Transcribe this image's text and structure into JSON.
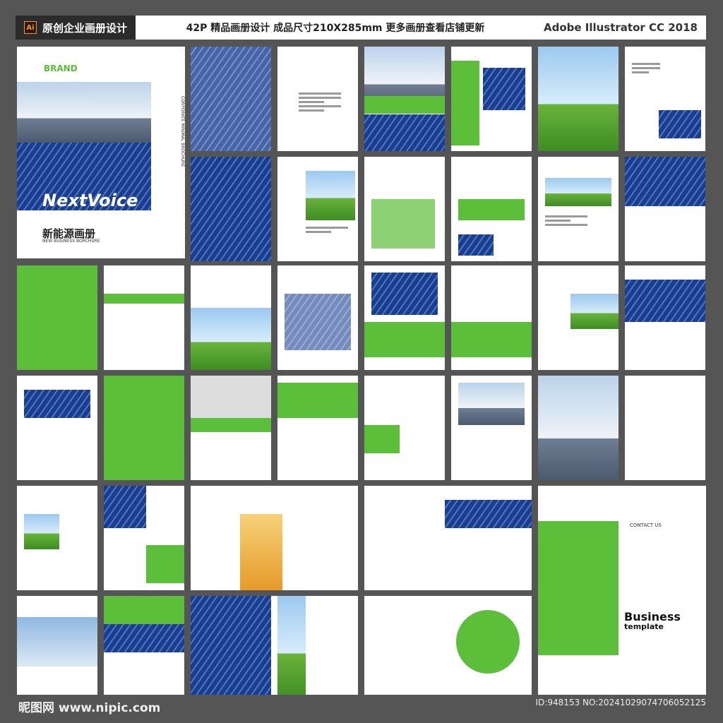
{
  "header": {
    "badge": "Ai",
    "left": "原创企业画册设计",
    "middle": "42P 精品画册设计 成品尺寸210X285mm 更多画册查看店铺更新",
    "right": "Adobe Illustrator CC 2018"
  },
  "cover": {
    "brand": "BRAND",
    "logo": "NextVoice",
    "title": "新能源画册",
    "subtitle": "NEW BUSINESS BORCHURE",
    "vertical": "CORPORATE MINIMAL BROCHURE"
  },
  "back": {
    "contact": "CONTACT US",
    "title1": "Business",
    "title2": "template"
  },
  "watermark": "昵图网 www.nipic.com",
  "id_text": "ID:948153 NO:20241029074706052125",
  "colors": {
    "accent": "#5bbf3a",
    "bg": "#555555"
  }
}
